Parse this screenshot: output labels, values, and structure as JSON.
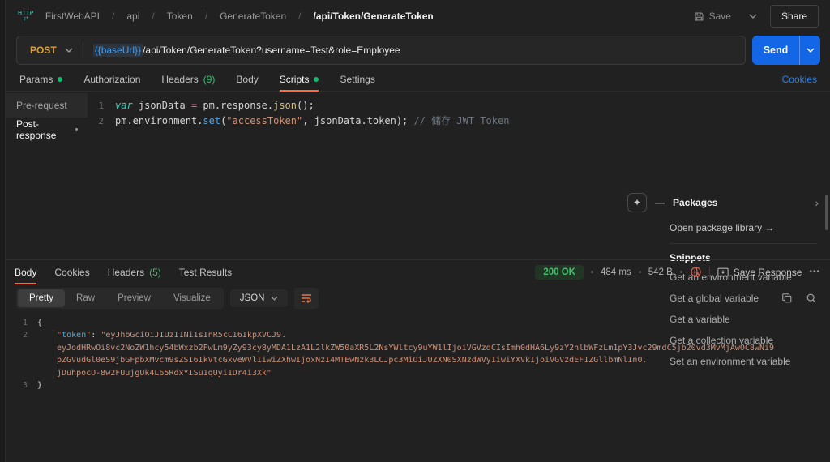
{
  "header": {
    "breadcrumb": {
      "items": [
        "FirstWebAPI",
        "api",
        "Token",
        "GenerateToken"
      ],
      "separator": "/",
      "current": "/api/Token/GenerateToken"
    },
    "save_label": "Save",
    "share_label": "Share"
  },
  "request_bar": {
    "method": "POST",
    "base_url": "{{baseUrl}}",
    "url_path": "/api/Token/GenerateToken?username=Test&role=Employee",
    "send_label": "Send"
  },
  "request_tabs": {
    "params": "Params",
    "authorization": "Authorization",
    "headers": "Headers",
    "headers_count": "(9)",
    "body": "Body",
    "scripts": "Scripts",
    "settings": "Settings",
    "cookies_link": "Cookies"
  },
  "scripts_panel": {
    "sidebar": {
      "pre_request": "Pre-request",
      "post_response": "Post-response"
    },
    "editor": {
      "line1": {
        "num": "1",
        "kw": "var",
        "ident": " jsonData ",
        "op": "=",
        "chain": " pm.response.",
        "fn": "json",
        "tail": "();"
      },
      "line2": {
        "num": "2",
        "chain": "pm.environment.",
        "fn": "set",
        "open": "(",
        "str": "\"accessToken\"",
        "tail": ", jsonData.token); ",
        "comment": "// 储存 JWT Token"
      }
    },
    "right_panel": {
      "packages_title": "Packages",
      "open_library": "Open package library →",
      "snippets_title": "Snippets",
      "snippets": [
        "Get an environment variable",
        "Get a global variable",
        "Get a variable",
        "Get a collection variable",
        "Set an environment variable"
      ]
    }
  },
  "response": {
    "tabs": {
      "body": "Body",
      "cookies": "Cookies",
      "headers": "Headers",
      "headers_count": "(5)",
      "test_results": "Test Results"
    },
    "status": "200 OK",
    "time": "484 ms",
    "size": "542 B",
    "save_response": "Save Response",
    "more": "•••",
    "view_tabs": {
      "pretty": "Pretty",
      "raw": "Raw",
      "preview": "Preview",
      "visualize": "Visualize",
      "format": "JSON"
    },
    "body": {
      "l1_num": "1",
      "l1": "{",
      "l2_num": "2",
      "indent": "    ",
      "key_q": "\"",
      "key": "token",
      "colon": ": ",
      "v1": "\"eyJhbGciOiJIUzI1NiIsInR5cCI6IkpXVCJ9.",
      "v2": "eyJodHRwOi8vc2NoZW1hcy54bWxzb2FwLm9yZy93cy8yMDA1LzA1L2lkZW50aXR5L2NsYWltcy9uYW1lIjoiVGVzdCIsImh0dHA6Ly9zY2hlbWFzLm1pY3Jvc29mdC5jb20vd3MvMjAwOC8wNi9",
      "v3": "pZGVudGl0eS9jbGFpbXMvcm9sZSI6IkVtcGxveWVlIiwiZXhwIjoxNzI4MTEwNzk3LCJpc3MiOiJUZXN0SXNzdWVyIiwiYXVkIjoiVGVzdEF1ZGllbmNlIn0.",
      "v4": "jDuhpocO-8w2FUujgUk4L65RdxYISu1qUyi1Dr4i3Xk\"",
      "l3_num": "3",
      "l3": "}"
    }
  }
}
